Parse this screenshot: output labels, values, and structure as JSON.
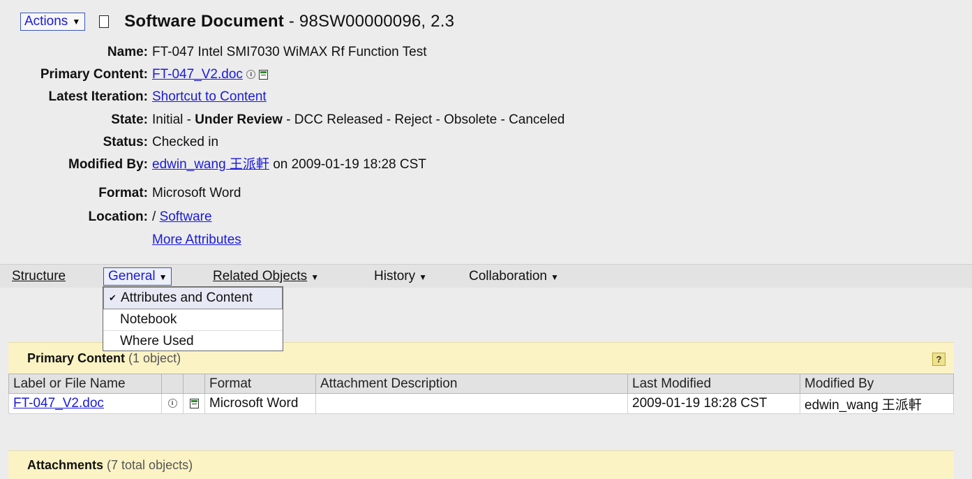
{
  "header": {
    "actions_label": "Actions",
    "title_bold": "Software Document",
    "title_rest": " - 98SW00000096, 2.3"
  },
  "attributes": {
    "name_label": "Name:",
    "name_value": "FT-047 Intel SMI7030 WiMAX Rf Function Test",
    "primary_content_label": "Primary Content:",
    "primary_content_value": "FT-047_V2.doc",
    "latest_iteration_label": "Latest Iteration:",
    "latest_iteration_value": "Shortcut to Content",
    "state_label": "State:",
    "state_before": "Initial - ",
    "state_current": "Under Review",
    "state_after": " - DCC Released - Reject - Obsolete - Canceled",
    "status_label": "Status:",
    "status_value": "Checked in",
    "modified_by_label": "Modified By:",
    "modified_by_user": "edwin_wang 王派軒",
    "modified_by_date": " on 2009-01-19 18:28 CST",
    "format_label": "Format:",
    "format_value": "Microsoft Word",
    "location_label": "Location:",
    "location_prefix": "/ ",
    "location_value": "Software",
    "more_attributes": "More Attributes"
  },
  "nav": {
    "structure": "Structure",
    "general": "General",
    "related_objects": "Related Objects",
    "history": "History",
    "collaboration": "Collaboration"
  },
  "menu": {
    "items": [
      "Attributes and Content",
      "Notebook",
      "Where Used"
    ],
    "check": "✔"
  },
  "primary_panel": {
    "title": "Primary Content",
    "count": " (1 object)",
    "help": "?",
    "columns": [
      "Label or File Name",
      "",
      "",
      "Format",
      "Attachment Description",
      "Last Modified",
      "Modified By"
    ],
    "row": {
      "file": "FT-047_V2.doc",
      "format": "Microsoft Word",
      "description": "",
      "last_modified": "2009-01-19 18:28 CST",
      "modified_by": "edwin_wang 王派軒"
    }
  },
  "attachments_panel": {
    "title": "Attachments",
    "count": " (7 total objects)"
  }
}
